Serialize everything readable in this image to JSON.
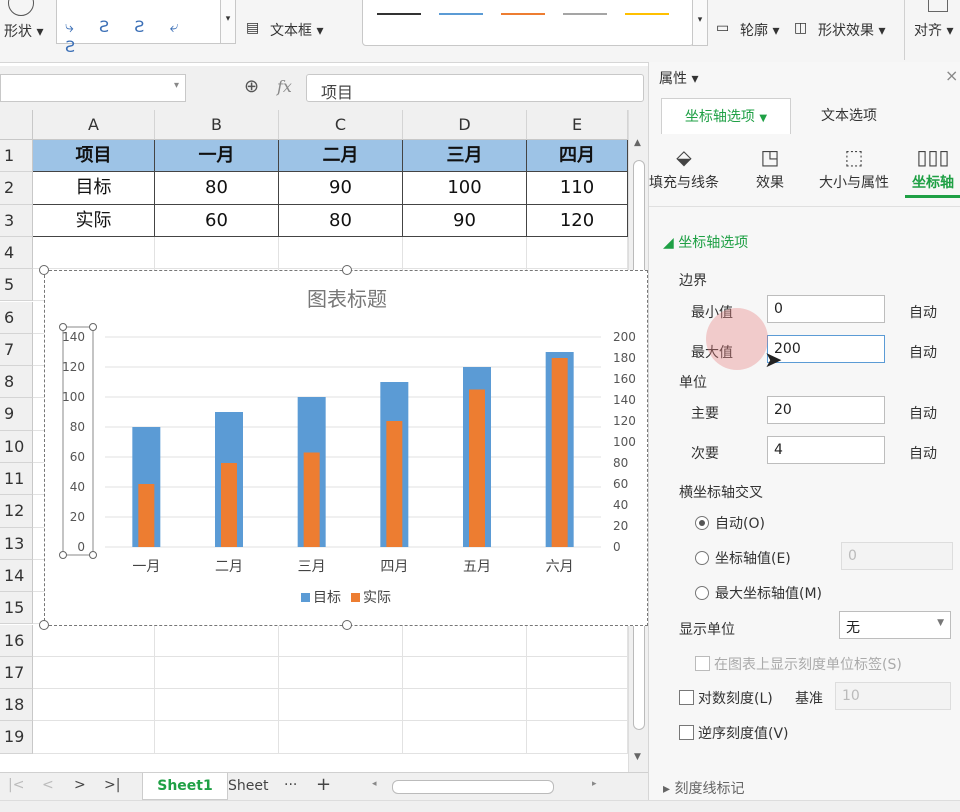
{
  "ribbon": {
    "shape_label": "形状",
    "textbox_label": "文本框",
    "outline_label": "轮廓",
    "shape_effect_label": "形状效果",
    "align_label": "对齐",
    "line_colors": [
      "#333333",
      "#5b9bd5",
      "#ed7d31",
      "#a5a5a5",
      "#ffc000"
    ]
  },
  "formula": {
    "fx_label": "fx",
    "value": "项目"
  },
  "sheet": {
    "columns": [
      "A",
      "B",
      "C",
      "D",
      "E"
    ],
    "row_numbers": [
      "1",
      "2",
      "3",
      "4",
      "5",
      "6",
      "7",
      "8",
      "9",
      "10",
      "11",
      "12",
      "13",
      "14",
      "15",
      "16",
      "17",
      "18",
      "19"
    ],
    "table": [
      [
        "项目",
        "一月",
        "二月",
        "三月",
        "四月"
      ],
      [
        "目标",
        "80",
        "90",
        "100",
        "110"
      ],
      [
        "实际",
        "60",
        "80",
        "90",
        "120"
      ]
    ],
    "header_color": "#9dc3e6"
  },
  "chart_data": {
    "type": "bar",
    "title": "图表标题",
    "categories": [
      "一月",
      "二月",
      "三月",
      "四月",
      "五月",
      "六月"
    ],
    "series": [
      {
        "name": "目标",
        "values": [
          80,
          90,
          100,
          110,
          120,
          130
        ],
        "color": "#5b9bd5",
        "axis": "primary"
      },
      {
        "name": "实际",
        "values": [
          60,
          80,
          90,
          120,
          150,
          180
        ],
        "color": "#ed7d31",
        "axis": "secondary"
      }
    ],
    "y_ticks": [
      "0",
      "20",
      "40",
      "60",
      "80",
      "100",
      "120",
      "140"
    ],
    "y2_ticks": [
      "0",
      "20",
      "40",
      "60",
      "80",
      "100",
      "120",
      "140",
      "160",
      "180",
      "200"
    ],
    "ylim": [
      0,
      140
    ],
    "y2lim": [
      0,
      200
    ],
    "grid": true,
    "legend": "bottom"
  },
  "tabs": {
    "active": "Sheet1",
    "other": "Sheet",
    "more": "···",
    "add": "+"
  },
  "panel": {
    "title": "属性",
    "tab_axis": "坐标轴选项",
    "tab_text": "文本选项",
    "icons": [
      {
        "label": "填充与线条",
        "icon": "paint-bucket-icon"
      },
      {
        "label": "效果",
        "icon": "effect-icon"
      },
      {
        "label": "大小与属性",
        "icon": "size-icon"
      },
      {
        "label": "坐标轴",
        "icon": "bar-chart-icon"
      }
    ],
    "section": "坐标轴选项",
    "bounds_label": "边界",
    "min_label": "最小值",
    "min_value": "0",
    "max_label": "最大值",
    "max_value": "200",
    "auto": "自动",
    "unit_label": "单位",
    "major_label": "主要",
    "major_value": "20",
    "minor_label": "次要",
    "minor_value": "4",
    "cross_label": "横坐标轴交叉",
    "radio_auto": "自动(O)",
    "radio_value": "坐标轴值(E)",
    "radio_value_input": "0",
    "radio_max": "最大坐标轴值(M)",
    "display_unit_label": "显示单位",
    "display_unit_value": "无",
    "show_unit_label": "在图表上显示刻度单位标签(S)",
    "log_label": "对数刻度(L)",
    "base_label": "基准",
    "base_value": "10",
    "reverse_label": "逆序刻度值(V)",
    "ticks_label": "刻度线标记",
    "accent": "#1fa045"
  }
}
